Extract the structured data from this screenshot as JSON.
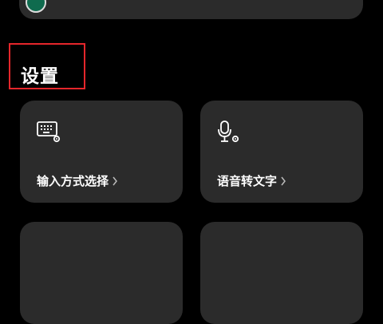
{
  "colors": {
    "background": "#000000",
    "card": "#2b2b2b",
    "highlight": "#e5262b",
    "avatar": "#0f6b4e"
  },
  "settings": {
    "title": "设置",
    "cards": [
      {
        "label": "输入方式选择",
        "icon": "keyboard-settings-icon"
      },
      {
        "label": "语音转文字",
        "icon": "microphone-settings-icon"
      }
    ]
  }
}
